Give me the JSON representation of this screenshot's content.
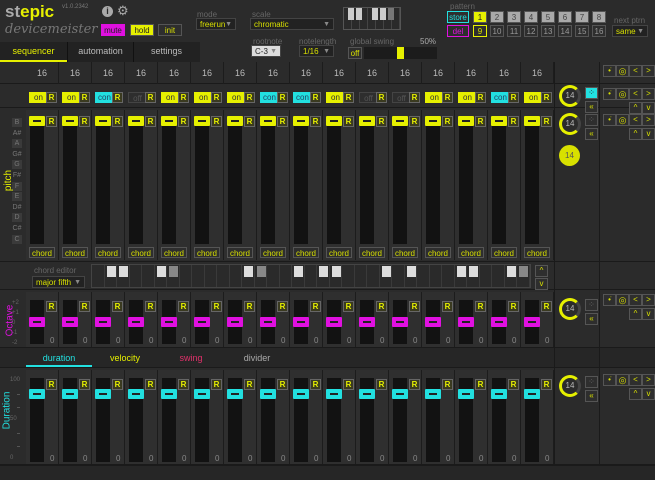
{
  "header": {
    "logo_st": "st",
    "logo_epic": "epic",
    "subtitle": "devicemeister",
    "version": "v1.0.2342",
    "mute": "mute",
    "hold": "hold",
    "init": "init",
    "mode_label": "mode",
    "mode_value": "freerun",
    "scale_label": "scale",
    "scale_value": "chromatic",
    "rootnote_label": "rootnote",
    "rootnote_value": "C-3",
    "notelength_label": "notelength",
    "notelength_value": "1/16",
    "swing_label": "global swing",
    "swing_value": "50%",
    "swing_toggle": "off",
    "swing_level": 0.5,
    "pattern_label": "pattern",
    "store": "store",
    "del": "del",
    "patterns": [
      "1",
      "2",
      "3",
      "4",
      "5",
      "6",
      "7",
      "8",
      "9",
      "10",
      "11",
      "12",
      "13",
      "14",
      "15",
      "16"
    ],
    "active_pattern": "1",
    "selected_pattern": "9",
    "next_label": "next ptrn",
    "next_value": "same"
  },
  "tabs": [
    "sequencer",
    "automation",
    "settings"
  ],
  "steps": {
    "counts": [
      "16",
      "16",
      "16",
      "16",
      "16",
      "16",
      "16",
      "16",
      "16",
      "16",
      "16",
      "16",
      "16",
      "16",
      "16",
      "16"
    ],
    "states": [
      "on",
      "on",
      "con",
      "off",
      "on",
      "on",
      "on",
      "con",
      "con",
      "on",
      "off",
      "off",
      "on",
      "on",
      "con",
      "on"
    ],
    "chord": "chord",
    "reset": "R"
  },
  "pitch": {
    "label": "pitch",
    "notes": [
      "B",
      "A#",
      "A",
      "G#",
      "G",
      "F#",
      "F",
      "E",
      "D#",
      "D",
      "C#",
      "C"
    ],
    "knob1": "14",
    "knob2": "14",
    "knob3": "14"
  },
  "chord_editor": {
    "label": "chord editor",
    "value": "major fifth"
  },
  "octave": {
    "label": "Octave",
    "scale": [
      "+2",
      "+1",
      "0",
      "-1",
      "-2"
    ],
    "value": "0",
    "knob": "14"
  },
  "subtabs": [
    "duration",
    "velocity",
    "swing",
    "divider"
  ],
  "duration": {
    "label": "Duration",
    "scale": [
      "100",
      "",
      "",
      "50",
      "",
      "",
      "0"
    ],
    "value": "0",
    "knob": "14"
  },
  "colors": {
    "accent": "#e6f000",
    "cyan": "#22e0e0",
    "magenta": "#e010e0",
    "swing": "#e0306a"
  }
}
